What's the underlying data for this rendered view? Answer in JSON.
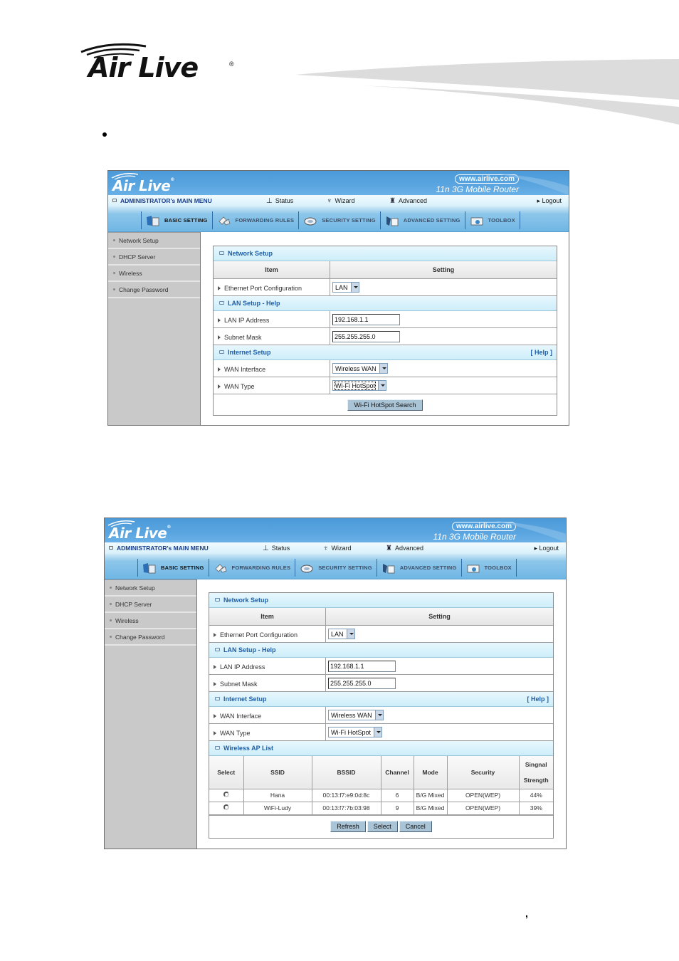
{
  "page": {
    "brand": "Air Live",
    "registered": "®",
    "bullet": "•",
    "stray_mark": ","
  },
  "router_ui": {
    "brand": "Air Live",
    "registered": "®",
    "url": "www.airlive.com",
    "product": "11n 3G Mobile Router",
    "main_menu": {
      "title": "ADMINISTRATOR's MAIN MENU",
      "items": [
        {
          "label": "Status",
          "icon": "status-icon"
        },
        {
          "label": "Wizard",
          "icon": "wizard-icon"
        },
        {
          "label": "Advanced",
          "icon": "advanced-icon"
        }
      ],
      "logout": "Logout"
    },
    "tabs": [
      {
        "label": "BASIC SETTING",
        "icon": "folder-icon",
        "active": true
      },
      {
        "label": "FORWARDING RULES",
        "icon": "forwarding-icon",
        "active": false
      },
      {
        "label": "SECURITY SETTING",
        "icon": "lock-icon",
        "active": false
      },
      {
        "label": "ADVANCED SETTING",
        "icon": "advanced-setting-icon",
        "active": false
      },
      {
        "label": "TOOLBOX",
        "icon": "toolbox-icon",
        "active": false
      }
    ],
    "sidebar": [
      {
        "label": "Network Setup"
      },
      {
        "label": "DHCP Server"
      },
      {
        "label": "Wireless"
      },
      {
        "label": "Change Password"
      }
    ],
    "sections": {
      "network_setup": "Network Setup",
      "col_item": "Item",
      "col_setting": "Setting",
      "ethernet_label": "Ethernet Port Configuration",
      "ethernet_value": "LAN",
      "lan_setup": "LAN Setup - Help",
      "lan_ip_label": "LAN IP Address",
      "lan_ip_value": "192.168.1.1",
      "subnet_label": "Subnet Mask",
      "subnet_value": "255.255.255.0",
      "internet_setup": "Internet Setup",
      "help_link": "[ Help ]",
      "wan_interface_label": "WAN Interface",
      "wan_interface_value": "Wireless WAN",
      "wan_type_label": "WAN Type",
      "wan_type_value": "Wi-Fi HotSpot"
    }
  },
  "screen1": {
    "search_button": "Wi-Fi HotSpot Search"
  },
  "screen2": {
    "ap_list": {
      "title": "Wireless AP List",
      "columns": [
        "Select",
        "SSID",
        "BSSID",
        "Channel",
        "Mode",
        "Security",
        "Singnal Strength"
      ],
      "rows": [
        {
          "selected": false,
          "ssid": "Hana",
          "bssid": "00:13:f7:e9:0d:8c",
          "channel": "6",
          "mode": "B/G Mixed",
          "security": "OPEN(WEP)",
          "signal": "44%"
        },
        {
          "selected": false,
          "ssid": "WiFi-Ludy",
          "bssid": "00:13:f7:7b:03:98",
          "channel": "9",
          "mode": "B/G Mixed",
          "security": "OPEN(WEP)",
          "signal": "39%"
        }
      ]
    },
    "buttons": {
      "refresh": "Refresh",
      "select": "Select",
      "cancel": "Cancel"
    }
  },
  "colors": {
    "header_blue": "#4b9ad9",
    "section_title": "#1e5ea8",
    "sidebar_gray": "#c9c9c9",
    "button_blue": "#a9c4d6"
  }
}
